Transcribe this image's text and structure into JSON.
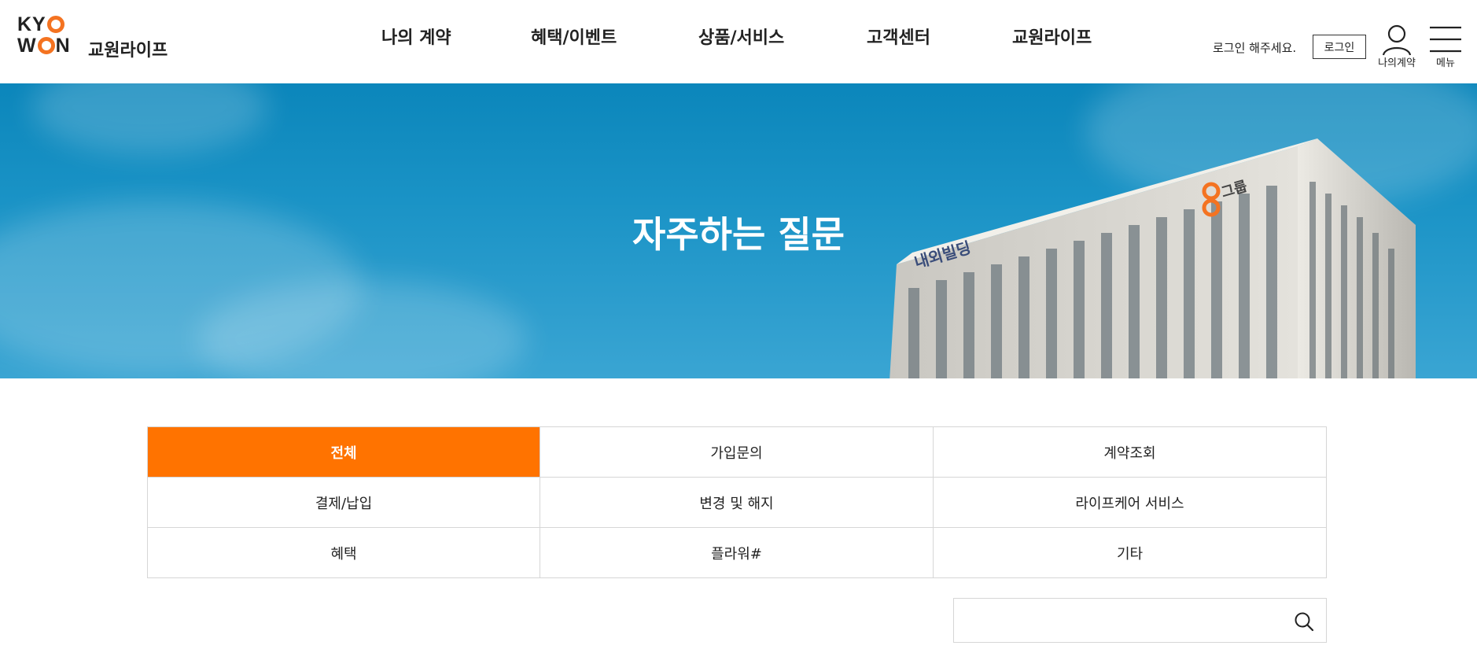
{
  "header": {
    "logo": {
      "line1": "KYO",
      "line2": "WON",
      "text": "교원라이프"
    },
    "nav": [
      "나의 계약",
      "혜택/이벤트",
      "상품/서비스",
      "고객센터",
      "교원라이프"
    ],
    "login_message": "로그인 해주세요.",
    "login_button": "로그인",
    "my_contract_label": "나의계약",
    "menu_label": "메뉴",
    "icons": [
      "user-icon",
      "hamburger-menu-icon"
    ]
  },
  "hero": {
    "title": "자주하는 질문",
    "building_sign_left": "내외빌딩",
    "building_sign_right": "KYO WON그룹"
  },
  "categories": [
    {
      "label": "전체",
      "active": true
    },
    {
      "label": "가입문의",
      "active": false
    },
    {
      "label": "계약조회",
      "active": false
    },
    {
      "label": "결제/납입",
      "active": false
    },
    {
      "label": "변경 및 해지",
      "active": false
    },
    {
      "label": "라이프케어 서비스",
      "active": false
    },
    {
      "label": "혜택",
      "active": false
    },
    {
      "label": "플라워#",
      "active": false
    },
    {
      "label": "기타",
      "active": false
    }
  ],
  "search": {
    "placeholder": "",
    "value": "",
    "icon": "search-icon"
  },
  "colors": {
    "accent": "#ff7300",
    "logo_orange": "#f47321",
    "sky": "#1a93c6"
  }
}
